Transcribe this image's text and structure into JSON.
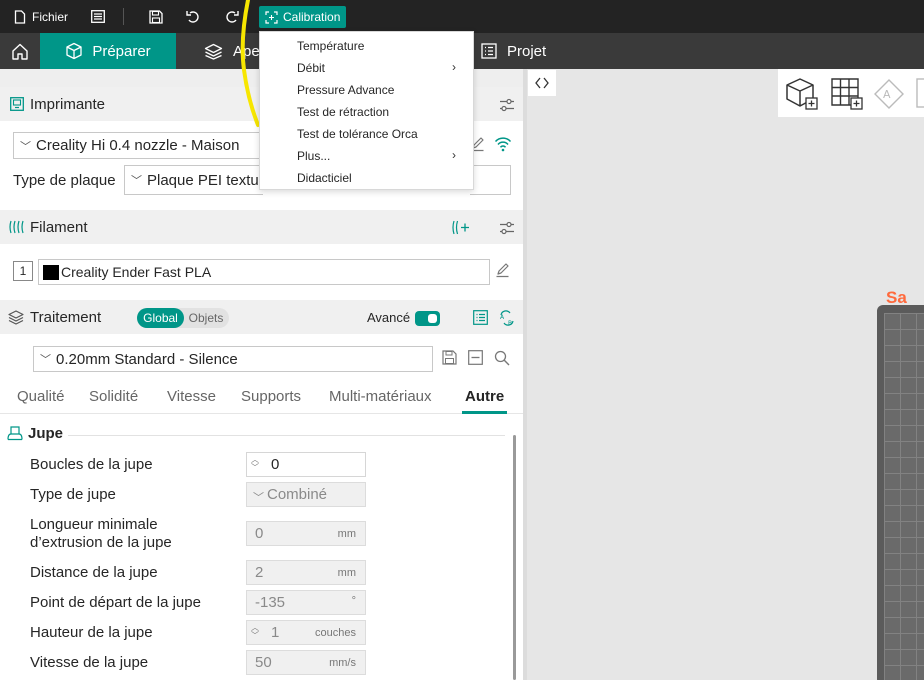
{
  "titlebar": {
    "fichier": "Fichier",
    "calibration": "Calibration"
  },
  "navbar": {
    "preparer": "Préparer",
    "apercu_partial": "Ape",
    "projet": "Projet"
  },
  "imprimante": {
    "title": "Imprimante",
    "printer": "Creality Hi 0.4 nozzle - Maison",
    "plate_label": "Type de plaque",
    "plate_value": "Plaque PEI textu"
  },
  "filament": {
    "title": "Filament",
    "index": "1",
    "name": "Creality Ender Fast PLA",
    "color": "#000000"
  },
  "traitement": {
    "title": "Traitement",
    "global": "Global",
    "objets": "Objets",
    "avance": "Avancé",
    "profile": "0.20mm Standard - Silence"
  },
  "tabs": [
    "Qualité",
    "Solidité",
    "Vitesse",
    "Supports",
    "Multi-matériaux",
    "Autre"
  ],
  "active_tab": "Autre",
  "jupe": {
    "title": "Jupe",
    "params": [
      {
        "label": "Boucles de la jupe",
        "value": "0",
        "unit": ""
      },
      {
        "label": "Type de jupe",
        "value": "Combiné",
        "unit": ""
      },
      {
        "label": "Longueur minimale",
        "label2": "d’extrusion de la jupe",
        "value": "0",
        "unit": "mm"
      },
      {
        "label": "Distance de la jupe",
        "value": "2",
        "unit": "mm"
      },
      {
        "label": "Point de départ de la jupe",
        "value": "-135",
        "unit": "°"
      },
      {
        "label": "Hauteur de la jupe",
        "value": "1",
        "unit": "couches"
      },
      {
        "label": "Vitesse de la jupe",
        "value": "50",
        "unit": "mm/s"
      }
    ]
  },
  "calibration_menu": {
    "items": [
      "Température",
      "Débit",
      "Pressure Advance",
      "Test de rétraction",
      "Test de tolérance Orca",
      "Plus...",
      "Didacticiel"
    ]
  },
  "canvas": {
    "plate_label_partial": "Sa"
  },
  "colors": {
    "accent": "#009688",
    "titlebar": "#232323",
    "navbar": "#3a3a3a",
    "plate_label": "#ff6a3d"
  }
}
